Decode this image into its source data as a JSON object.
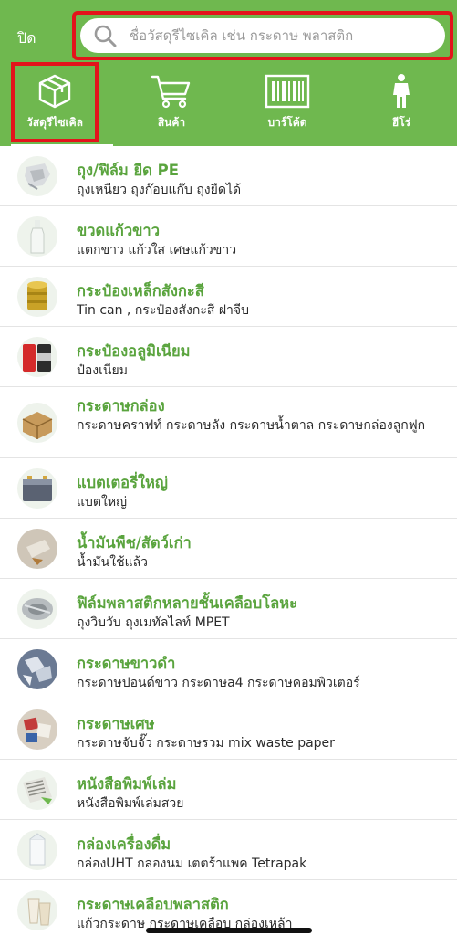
{
  "header": {
    "close_label": "ปิด",
    "search_placeholder": "ชื่อวัสดุรีไซเคิล เช่น กระดาษ พลาสติก",
    "accent_color": "#6fb84f",
    "highlight_color": "#e3141b"
  },
  "tabs": [
    {
      "label": "วัสดุรีไซเคิล",
      "icon": "box-icon",
      "selected": true
    },
    {
      "label": "สินค้า",
      "icon": "cart-icon",
      "selected": false
    },
    {
      "label": "บาร์โค้ด",
      "icon": "barcode-icon",
      "selected": false
    },
    {
      "label": "ฮีโร่",
      "icon": "hero-icon",
      "selected": false
    }
  ],
  "items": [
    {
      "title": "ถุง/ฟิล์ม ยืด PE",
      "desc": "ถุงเหนียว ถุงก๊อบแก๊บ ถุงยืดได้"
    },
    {
      "title": "ขวดแก้วขาว",
      "desc": "แตกขาว แก้วใส เศษแก้วขาว"
    },
    {
      "title": "กระป๋องเหล็กสังกะสี",
      "desc": "Tin can , กระป๋องสังกะสี ฝาจีบ"
    },
    {
      "title": "กระป๋องอลูมิเนียม",
      "desc": "ป๋องเนียม"
    },
    {
      "title": "กระดาษกล่อง",
      "desc": "กระดาษคราฟท์ กระดาษลัง กระดาษน้ำตาล กระดาษกล่องลูกฟูก"
    },
    {
      "title": "แบตเตอรี่ใหญ่",
      "desc": "แบตใหญ่"
    },
    {
      "title": "น้ำมันพืช/สัตว์เก่า",
      "desc": "น้ำมันใช้แล้ว"
    },
    {
      "title": "ฟิล์มพลาสติกหลายชั้นเคลือบโลหะ",
      "desc": "ถุงวิบวับ ถุงเมทัลไลท์ MPET"
    },
    {
      "title": "กระดาษขาวดำ",
      "desc": "กระดาษปอนด์ขาว กระดาษa4 กระดาษคอมพิวเตอร์"
    },
    {
      "title": "กระดาษเศษ",
      "desc": "กระดาษจับจั๊ว กระดาษรวม mix waste paper"
    },
    {
      "title": "หนังสือพิมพ์เล่ม",
      "desc": "หนังสือพิมพ์เล่มสวย"
    },
    {
      "title": "กล่องเครื่องดื่ม",
      "desc": "กล่องUHT กล่องนม เตตร้าแพค Tetrapak"
    },
    {
      "title": "กระดาษเคลือบพลาสติก",
      "desc": "แก้วกระดาษ กระดาษเคลือบ กล่องเหล้า"
    }
  ]
}
